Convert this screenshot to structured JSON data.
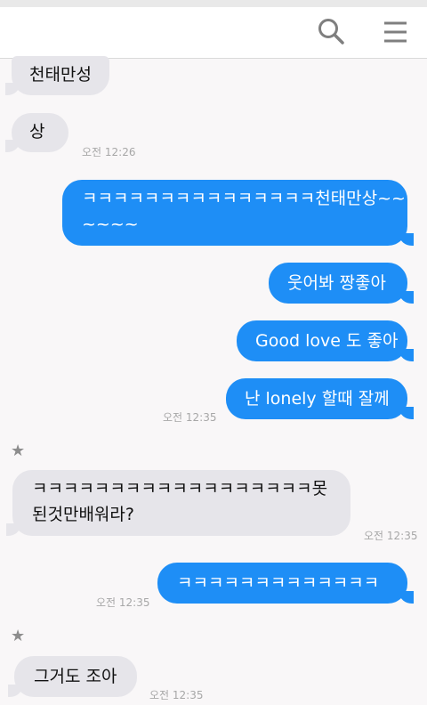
{
  "header": {
    "search_icon": "search-icon",
    "menu_icon": "hamburger-menu-icon"
  },
  "messages": {
    "m1": {
      "text": "천태만성"
    },
    "m2": {
      "text": "상",
      "time": "오전 12:26"
    },
    "m3": {
      "line1": "ㅋㅋㅋㅋㅋㅋㅋㅋㅋㅋㅋㅋㅋㅋㅋ천태만상~~",
      "line2": "~~~~"
    },
    "m4": {
      "text": "웃어봐 짱좋아"
    },
    "m5": {
      "text": "Good love 도 좋아"
    },
    "m6": {
      "text": "난 lonely 할때 잘께",
      "time": "오전 12:35"
    },
    "m7": {
      "line1": "ㅋㅋㅋㅋㅋㅋㅋㅋㅋㅋㅋㅋㅋㅋㅋㅋㅋㅋ못",
      "line2": "된것만배워라?",
      "time": "오전 12:35"
    },
    "m8": {
      "text": "ㅋㅋㅋㅋㅋㅋㅋㅋㅋㅋㅋㅋㅋ",
      "time": "오전 12:35"
    },
    "m9": {
      "text": "그거도 조아",
      "time": "오전 12:35"
    }
  },
  "marks": {
    "star": "★"
  },
  "colors": {
    "outgoing": "#1e8ef6",
    "incoming": "#e6e5ea",
    "timestamp": "#a7a7a7"
  }
}
